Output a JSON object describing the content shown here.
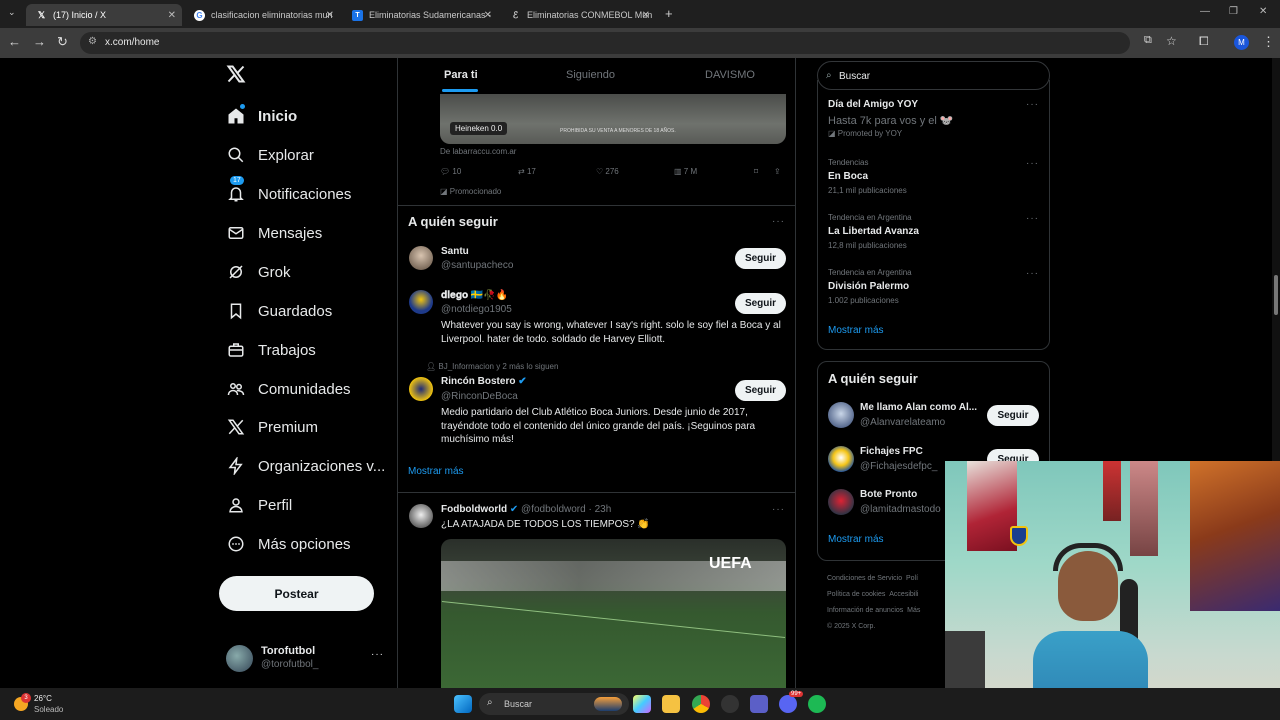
{
  "browser": {
    "tabs": [
      {
        "label": "(17) Inicio / X",
        "icon": "x-logo-icon"
      },
      {
        "label": "clasificacion eliminatorias mun",
        "icon": "google-icon"
      },
      {
        "label": "Eliminatorias Sudamericanas - ",
        "icon": "site-icon"
      },
      {
        "label": "Eliminatorias CONMEBOL Mun",
        "icon": "site-icon"
      }
    ],
    "url": "x.com/home",
    "profile_letter": "M"
  },
  "sidebar": {
    "items": [
      {
        "label": "Inicio",
        "icon": "home-icon"
      },
      {
        "label": "Explorar",
        "icon": "search-icon"
      },
      {
        "label": "Notificaciones",
        "icon": "bell-icon",
        "badge": "17"
      },
      {
        "label": "Mensajes",
        "icon": "mail-icon"
      },
      {
        "label": "Grok",
        "icon": "grok-icon"
      },
      {
        "label": "Guardados",
        "icon": "bookmark-icon"
      },
      {
        "label": "Trabajos",
        "icon": "briefcase-icon"
      },
      {
        "label": "Comunidades",
        "icon": "people-icon"
      },
      {
        "label": "Premium",
        "icon": "x-logo-icon"
      },
      {
        "label": "Organizaciones v...",
        "icon": "lightning-icon"
      },
      {
        "label": "Perfil",
        "icon": "person-icon"
      },
      {
        "label": "Más opciones",
        "icon": "more-circle-icon"
      }
    ],
    "post_label": "Postear",
    "account": {
      "name": "Torofutbol",
      "handle": "@torofutbol_"
    }
  },
  "main": {
    "tabs": [
      "Para ti",
      "Siguiendo",
      "DAVISMO"
    ],
    "ad": {
      "image_label": "Heineken 0.0",
      "image_caption": "PROHIBIDA SU VENTA A MENORES DE 18 AÑOS.",
      "source": "De labarraccu.com.ar",
      "replies": "10",
      "reposts": "17",
      "likes": "276",
      "views": "7 M",
      "promoted": "Promocionado"
    },
    "who_to_follow": {
      "title": "A quién seguir",
      "users": [
        {
          "name": "Santu",
          "handle": "@santupacheco",
          "bio": ""
        },
        {
          "name": "𝐝𝐢𝐞𝐠𝐨 🇸🇪🥀🔥",
          "handle": "@notdiego1905",
          "bio": "Whatever you say is wrong, whatever I say's right. solo le soy fiel a Boca y al Liverpool. hater de todo. soldado de Harvey Elliott."
        },
        {
          "name": "Rincón Bostero",
          "handle": "@RinconDeBoca",
          "context": "BJ_Informacion y 2 más lo siguen",
          "bio": "Medio partidario del Club Atlético Boca Juniors. Desde junio de 2017, trayéndote todo el contenido del único grande del país. ¡Seguinos para muchísimo más!"
        }
      ],
      "follow_label": "Seguir",
      "show_more": "Mostrar más"
    },
    "tweet": {
      "name": "Fodboldworld",
      "handle": "@fodboldword",
      "time": "· 23h",
      "text": "¿LA ATAJADA DE TODOS LOS TIEMPOS? 👏",
      "media_label": "UEFA"
    }
  },
  "right": {
    "search_placeholder": "Buscar",
    "trends": [
      {
        "context": "",
        "name": "Día del Amigo YOY",
        "sub": "Hasta 7k para vos y el 🐭",
        "promoted": "Promoted by YOY"
      },
      {
        "context": "Tendencias",
        "name": "En Boca",
        "sub": "21,1 mil publicaciones"
      },
      {
        "context": "Tendencia en Argentina",
        "name": "La Libertad Avanza",
        "sub": "12,8 mil publicaciones"
      },
      {
        "context": "Tendencia en Argentina",
        "name": "División Palermo",
        "sub": "1.002 publicaciones"
      }
    ],
    "trends_more": "Mostrar más",
    "follow_title": "A quién seguir",
    "follow_users": [
      {
        "name": "Me llamo Alan como Al...",
        "handle": "@Alanvarelateamo"
      },
      {
        "name": "Fichajes FPC",
        "handle": "@Fichajesdefpc_"
      },
      {
        "name": "Bote Pronto",
        "handle": "@lamitadmastodo"
      }
    ],
    "follow_label": "Seguir",
    "follow_more": "Mostrar más",
    "footer": [
      "Condiciones de Servicio",
      "Polí",
      "Política de cookies",
      "Accesibili",
      "Información de anuncios",
      "Más",
      "© 2025 X Corp."
    ]
  },
  "taskbar": {
    "weather_temp": "26°C",
    "weather_desc": "Soleado",
    "weather_badge": "3",
    "search_label": "Buscar",
    "chat_badge": "99+"
  },
  "colors": {
    "accent": "#1d9bf0",
    "background": "#000000",
    "border": "#2f3336"
  }
}
